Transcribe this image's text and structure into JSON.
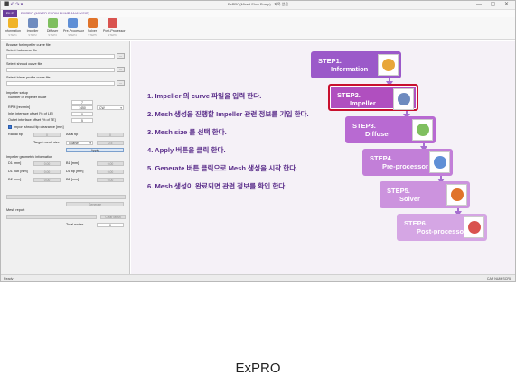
{
  "window": {
    "title": "ExPRO(Mixed Flow Pump) - 제목 없음",
    "quick_access": "⬛ ↶ ↷ ▾",
    "controls": "— ▢ ✕"
  },
  "menu": {
    "file": "FILE",
    "title": "EXPRO (MIXED FLOW PUMP ANALYSIS)"
  },
  "ribbon": [
    {
      "label": "Information",
      "step": "STEP1",
      "color": "#f0b429",
      "icon": "folder-icon"
    },
    {
      "label": "Impeller",
      "step": "STEP2",
      "color": "#6e8bbf",
      "icon": "impeller-icon"
    },
    {
      "label": "Diffuser",
      "step": "STEP3",
      "color": "#7fbf5f",
      "icon": "diffuser-icon"
    },
    {
      "label": "Pre-Processor",
      "step": "STEP4",
      "color": "#5f8fd6",
      "icon": "mesh-icon"
    },
    {
      "label": "Solver",
      "step": "STEP5",
      "color": "#e0732a",
      "icon": "solver-icon"
    },
    {
      "label": "Post-Processor",
      "step": "STEP6",
      "color": "#d9534f",
      "icon": "chart-icon"
    }
  ],
  "left": {
    "browse_title": "Browse for impeller curve file",
    "hub_label": "Select hub curve file",
    "shroud_label": "Select shroud curve file",
    "blade_label": "Select blade profile curve file",
    "browse_btn": "...",
    "setup_title": "Impeller setup",
    "num_blade_label": "Number of impeller blade",
    "num_blade": "7",
    "rpm_label": "RPM [rev/min]",
    "rpm": "1450",
    "rpm_unit": "CW",
    "inlet_label": "Inlet interface offset [% of LE]",
    "inlet": "0",
    "outlet_label": "Outlet interface offset [% of TE]",
    "outlet": "5",
    "import_label": "Import shroud tip clearance [mm]",
    "radial_tip_label": "Radial tip",
    "radial_tip": "0",
    "axial_tip_label": "Axial tip",
    "axial_tip": "0",
    "target_mesh_label": "Target mesh size",
    "target_mesh": "Coarse",
    "target_mesh_val": "0.5",
    "apply": "Apply",
    "geo_title": "Impeller geometric information",
    "geo": [
      {
        "k": "D1 [mm]",
        "v": "0.00",
        "k2": "B1 [mm]",
        "v2": "0.00"
      },
      {
        "k": "D1 hub [mm]",
        "v": "0.00",
        "k2": "D1 tip [mm]",
        "v2": "0.00"
      },
      {
        "k": "D2 [mm]",
        "v": "0.00",
        "k2": "B2 [mm]",
        "v2": "0.00"
      }
    ],
    "generate": "Generate",
    "mesh_report": "Mesh report",
    "clear_btn": "Clear Mesh",
    "total_nodes_label": "Total nodes",
    "total_nodes": "0"
  },
  "instructions": [
    "1.  Impeller 의 curve 파일을 입력 한다.",
    "2.  Mesh 생성을 진행할 Impeller 관련 정보를 기입 한다.",
    "3.  Mesh size 를 선택 한다.",
    "4.  Apply 버튼을 클릭 한다.",
    "5.  Generate 버튼 클릭으로 Mesh 생성을 시작 한다.",
    "6.  Mesh 생성이 완료되면 관련 정보를 확인 한다."
  ],
  "steps": [
    {
      "num": "STEP1.",
      "name": "Information",
      "color": "#9b59c9",
      "active": false
    },
    {
      "num": "STEP2.",
      "name": "Impeller",
      "color": "#b04fbf",
      "active": true
    },
    {
      "num": "STEP3.",
      "name": "Diffuser",
      "color": "#b86ad2",
      "active": false
    },
    {
      "num": "STEP4.",
      "name": "Pre-processor",
      "color": "#c27fd8",
      "active": false
    },
    {
      "num": "STEP5.",
      "name": "Solver",
      "color": "#cc93de",
      "active": false
    },
    {
      "num": "STEP6.",
      "name": "Post-processor",
      "color": "#d5a6e4",
      "active": false
    }
  ],
  "status": {
    "left": "Ready",
    "right": "CAP  NUM  SCRL"
  },
  "caption": "ExPRO"
}
